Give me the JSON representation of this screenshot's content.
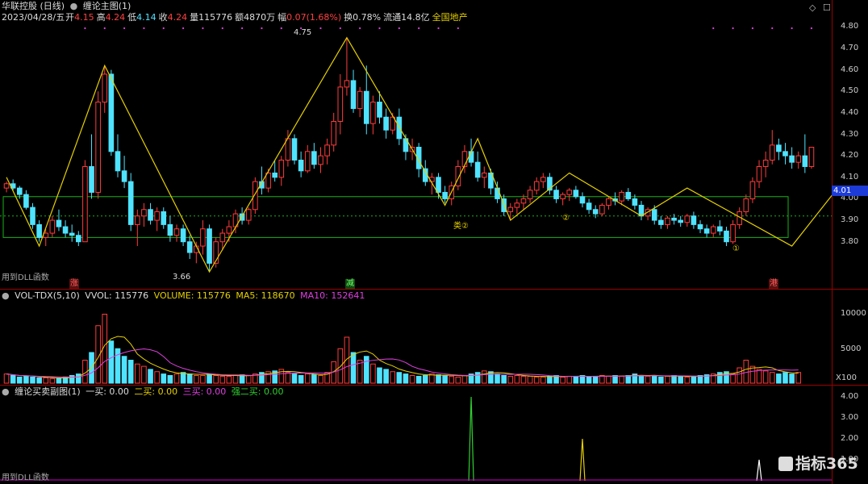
{
  "header": {
    "stock": "华联控股 (日线)",
    "indicator_main": "缠论主图(1)",
    "date": "2023/04/28/五",
    "open_label": "开",
    "open": "4.15",
    "high_label": "高",
    "high": "4.24",
    "low_label": "低",
    "low": "4.14",
    "close_label": "收",
    "close": "4.24",
    "vol_label": "量",
    "vol": "115776",
    "amt_label": "额",
    "amt": "4870万",
    "chg_label": "幅",
    "chg": "0.07(1.68%)",
    "turn_label": "换",
    "turn": "0.78%",
    "float_label": "流通",
    "float": "14.8亿",
    "sector": "全国地产"
  },
  "price_axis": [
    "4.80",
    "4.70",
    "4.60",
    "4.50",
    "4.40",
    "4.30",
    "4.20",
    "4.10",
    "4.00",
    "3.90",
    "3.80"
  ],
  "current_price": "4.01",
  "annotations": {
    "high_label": "4.75",
    "low_label": "3.66",
    "buy2_a": "类②",
    "buy2_b": "②",
    "buy2_c": "②",
    "buy1": "①",
    "dll_note_main": "用到DLL函数",
    "dll_note_sub": "用到DLL函数"
  },
  "markers": {
    "m1": "涨",
    "m2": "减",
    "m3": "港"
  },
  "volume_header": {
    "name": "VOL-TDX(5,10)",
    "vvol": "VVOL: 115776",
    "volume": "VOLUME: 115776",
    "ma5": "MA5: 118670",
    "ma10": "MA10: 152641"
  },
  "volume_axis": [
    "10000",
    "5000"
  ],
  "volume_unit": "X100",
  "sub_header": {
    "name": "缠论买卖副图(1)",
    "buy1": "一买: 0.00",
    "buy2": "二买: 0.00",
    "buy3": "三买: 0.00",
    "strong2": "强二买: 0.00"
  },
  "sub_axis": [
    "4.00",
    "3.00",
    "2.00",
    "1.00"
  ],
  "watermark": "指标365",
  "colors": {
    "up": "#ff3c3c",
    "down": "#4fe3ff",
    "zigzag": "#e6d000",
    "zone": "#19b319",
    "magenta": "#e040e0"
  },
  "chart_data": {
    "type": "candlestick",
    "ylim": [
      3.6,
      4.85
    ],
    "candles": [
      [
        4.05,
        4.08,
        4.03,
        4.07
      ],
      [
        4.07,
        4.09,
        4.04,
        4.05
      ],
      [
        4.05,
        4.06,
        4.0,
        4.02
      ],
      [
        4.02,
        4.04,
        3.95,
        3.96
      ],
      [
        3.96,
        3.98,
        3.86,
        3.88
      ],
      [
        3.88,
        3.9,
        3.8,
        3.82
      ],
      [
        3.82,
        3.86,
        3.78,
        3.84
      ],
      [
        3.84,
        3.92,
        3.82,
        3.9
      ],
      [
        3.9,
        3.95,
        3.85,
        3.87
      ],
      [
        3.87,
        3.9,
        3.82,
        3.84
      ],
      [
        3.84,
        3.88,
        3.8,
        3.83
      ],
      [
        3.83,
        3.85,
        3.78,
        3.8
      ],
      [
        3.8,
        4.18,
        3.8,
        4.15
      ],
      [
        4.15,
        4.3,
        4.0,
        4.03
      ],
      [
        4.03,
        4.5,
        4.0,
        4.45
      ],
      [
        4.45,
        4.62,
        4.4,
        4.58
      ],
      [
        4.58,
        4.6,
        4.2,
        4.22
      ],
      [
        4.22,
        4.3,
        4.1,
        4.13
      ],
      [
        4.13,
        4.2,
        4.05,
        4.08
      ],
      [
        4.08,
        4.12,
        3.85,
        3.88
      ],
      [
        3.88,
        3.95,
        3.78,
        3.92
      ],
      [
        3.92,
        3.98,
        3.87,
        3.95
      ],
      [
        3.95,
        3.98,
        3.88,
        3.9
      ],
      [
        3.9,
        3.96,
        3.85,
        3.94
      ],
      [
        3.94,
        3.96,
        3.86,
        3.88
      ],
      [
        3.88,
        3.92,
        3.8,
        3.83
      ],
      [
        3.83,
        3.88,
        3.8,
        3.86
      ],
      [
        3.86,
        3.88,
        3.78,
        3.8
      ],
      [
        3.8,
        3.83,
        3.72,
        3.75
      ],
      [
        3.75,
        3.8,
        3.7,
        3.78
      ],
      [
        3.78,
        3.9,
        3.74,
        3.86
      ],
      [
        3.86,
        3.88,
        3.66,
        3.7
      ],
      [
        3.7,
        3.82,
        3.68,
        3.8
      ],
      [
        3.8,
        3.86,
        3.76,
        3.84
      ],
      [
        3.84,
        3.9,
        3.8,
        3.87
      ],
      [
        3.87,
        3.95,
        3.84,
        3.93
      ],
      [
        3.93,
        3.96,
        3.88,
        3.9
      ],
      [
        3.9,
        3.96,
        3.88,
        3.95
      ],
      [
        3.95,
        4.1,
        3.93,
        4.08
      ],
      [
        4.08,
        4.15,
        4.02,
        4.05
      ],
      [
        4.05,
        4.14,
        4.03,
        4.12
      ],
      [
        4.12,
        4.18,
        4.08,
        4.1
      ],
      [
        4.1,
        4.2,
        4.06,
        4.18
      ],
      [
        4.18,
        4.32,
        4.15,
        4.28
      ],
      [
        4.28,
        4.3,
        4.16,
        4.18
      ],
      [
        4.18,
        4.22,
        4.1,
        4.13
      ],
      [
        4.13,
        4.25,
        4.12,
        4.22
      ],
      [
        4.22,
        4.26,
        4.14,
        4.16
      ],
      [
        4.16,
        4.24,
        4.12,
        4.2
      ],
      [
        4.2,
        4.28,
        4.16,
        4.25
      ],
      [
        4.25,
        4.4,
        4.22,
        4.36
      ],
      [
        4.36,
        4.58,
        4.3,
        4.52
      ],
      [
        4.52,
        4.75,
        4.48,
        4.55
      ],
      [
        4.55,
        4.6,
        4.4,
        4.42
      ],
      [
        4.42,
        4.52,
        4.38,
        4.5
      ],
      [
        4.5,
        4.62,
        4.3,
        4.35
      ],
      [
        4.35,
        4.48,
        4.3,
        4.45
      ],
      [
        4.45,
        4.5,
        4.35,
        4.38
      ],
      [
        4.38,
        4.42,
        4.28,
        4.32
      ],
      [
        4.32,
        4.4,
        4.3,
        4.38
      ],
      [
        4.38,
        4.42,
        4.25,
        4.28
      ],
      [
        4.28,
        4.3,
        4.18,
        4.22
      ],
      [
        4.22,
        4.28,
        4.18,
        4.24
      ],
      [
        4.24,
        4.26,
        4.1,
        4.14
      ],
      [
        4.14,
        4.18,
        4.06,
        4.08
      ],
      [
        4.08,
        4.12,
        4.02,
        4.1
      ],
      [
        4.1,
        4.12,
        4.0,
        4.03
      ],
      [
        4.03,
        4.06,
        3.98,
        4.0
      ],
      [
        4.0,
        4.08,
        3.97,
        4.06
      ],
      [
        4.06,
        4.18,
        4.04,
        4.15
      ],
      [
        4.15,
        4.25,
        4.12,
        4.22
      ],
      [
        4.22,
        4.28,
        4.15,
        4.17
      ],
      [
        4.17,
        4.22,
        4.08,
        4.1
      ],
      [
        4.1,
        4.15,
        4.05,
        4.12
      ],
      [
        4.12,
        4.14,
        4.02,
        4.05
      ],
      [
        4.05,
        4.08,
        3.98,
        4.0
      ],
      [
        4.0,
        4.02,
        3.92,
        3.94
      ],
      [
        3.94,
        3.98,
        3.9,
        3.96
      ],
      [
        3.96,
        4.0,
        3.93,
        3.98
      ],
      [
        3.98,
        4.02,
        3.95,
        4.0
      ],
      [
        4.0,
        4.06,
        3.98,
        4.04
      ],
      [
        4.04,
        4.1,
        4.02,
        4.08
      ],
      [
        4.08,
        4.12,
        4.05,
        4.1
      ],
      [
        4.1,
        4.12,
        4.02,
        4.04
      ],
      [
        4.04,
        4.06,
        3.98,
        4.0
      ],
      [
        4.0,
        4.03,
        3.97,
        4.02
      ],
      [
        4.02,
        4.05,
        3.99,
        4.04
      ],
      [
        4.04,
        4.06,
        4.0,
        4.01
      ],
      [
        4.01,
        4.03,
        3.96,
        3.98
      ],
      [
        3.98,
        4.0,
        3.93,
        3.95
      ],
      [
        3.95,
        3.97,
        3.91,
        3.93
      ],
      [
        3.93,
        3.98,
        3.92,
        3.97
      ],
      [
        3.97,
        4.01,
        3.95,
        4.0
      ],
      [
        4.0,
        4.03,
        3.97,
        3.99
      ],
      [
        3.99,
        4.04,
        3.97,
        4.03
      ],
      [
        4.03,
        4.05,
        3.99,
        4.0
      ],
      [
        4.0,
        4.02,
        3.95,
        3.97
      ],
      [
        3.97,
        3.99,
        3.9,
        3.92
      ],
      [
        3.92,
        3.96,
        3.9,
        3.95
      ],
      [
        3.95,
        3.97,
        3.88,
        3.9
      ],
      [
        3.9,
        3.92,
        3.86,
        3.88
      ],
      [
        3.88,
        3.92,
        3.86,
        3.91
      ],
      [
        3.91,
        3.93,
        3.88,
        3.9
      ],
      [
        3.9,
        3.92,
        3.87,
        3.89
      ],
      [
        3.89,
        3.93,
        3.87,
        3.92
      ],
      [
        3.92,
        3.94,
        3.86,
        3.88
      ],
      [
        3.88,
        3.9,
        3.84,
        3.86
      ],
      [
        3.86,
        3.88,
        3.82,
        3.84
      ],
      [
        3.84,
        3.88,
        3.82,
        3.87
      ],
      [
        3.87,
        3.9,
        3.83,
        3.85
      ],
      [
        3.85,
        3.87,
        3.78,
        3.8
      ],
      [
        3.8,
        3.9,
        3.79,
        3.88
      ],
      [
        3.88,
        3.96,
        3.86,
        3.94
      ],
      [
        3.94,
        4.02,
        3.92,
        4.0
      ],
      [
        4.0,
        4.1,
        3.98,
        4.08
      ],
      [
        4.08,
        4.18,
        4.05,
        4.15
      ],
      [
        4.15,
        4.22,
        4.1,
        4.18
      ],
      [
        4.18,
        4.32,
        4.16,
        4.25
      ],
      [
        4.25,
        4.28,
        4.18,
        4.22
      ],
      [
        4.22,
        4.26,
        4.16,
        4.2
      ],
      [
        4.2,
        4.24,
        4.14,
        4.17
      ],
      [
        4.17,
        4.22,
        4.14,
        4.2
      ],
      [
        4.2,
        4.3,
        4.12,
        4.15
      ],
      [
        4.15,
        4.24,
        4.14,
        4.24
      ]
    ],
    "zigzag": [
      [
        0,
        4.1
      ],
      [
        5,
        3.78
      ],
      [
        15,
        4.62
      ],
      [
        31,
        3.66
      ],
      [
        52,
        4.75
      ],
      [
        67,
        3.97
      ],
      [
        72,
        4.28
      ],
      [
        77,
        3.9
      ],
      [
        86,
        4.12
      ],
      [
        97,
        3.92
      ],
      [
        104,
        4.05
      ],
      [
        120,
        3.78
      ],
      [
        134,
        4.32
      ]
    ],
    "zone": {
      "top": 4.01,
      "bottom": 3.82,
      "start": 0,
      "end": 136
    },
    "volume": [
      12,
      10,
      8,
      9,
      8,
      7,
      7,
      6,
      6,
      8,
      10,
      12,
      30,
      40,
      75,
      90,
      55,
      45,
      35,
      30,
      25,
      22,
      18,
      15,
      12,
      10,
      12,
      14,
      12,
      10,
      10,
      12,
      10,
      9,
      9,
      10,
      11,
      10,
      12,
      14,
      15,
      16,
      18,
      14,
      12,
      10,
      12,
      11,
      10,
      14,
      28,
      45,
      60,
      40,
      30,
      35,
      25,
      20,
      18,
      15,
      14,
      12,
      10,
      9,
      10,
      12,
      11,
      10,
      9,
      8,
      10,
      12,
      14,
      16,
      15,
      12,
      10,
      9,
      10,
      9,
      9,
      8,
      8,
      9,
      10,
      8,
      9,
      9,
      10,
      8,
      9,
      10,
      9,
      10,
      9,
      10,
      12,
      10,
      9,
      10,
      8,
      9,
      10,
      9,
      8,
      9,
      10,
      11,
      12,
      14,
      15,
      12,
      20,
      30,
      22,
      18,
      16,
      14,
      12,
      14,
      12,
      14
    ]
  }
}
